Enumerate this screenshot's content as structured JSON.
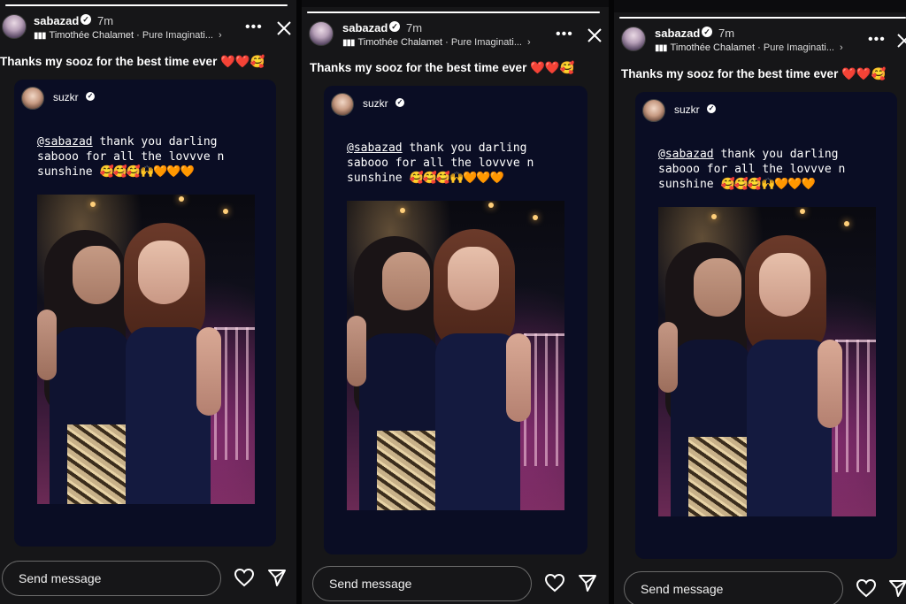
{
  "story": {
    "username": "sabazad",
    "time": "7m",
    "music_artist": "Timothée Chalamet",
    "music_song": "Pure Imaginati...",
    "caption_text": "Thanks my sooz for the best time ever",
    "caption_emojis": "❤️❤️🥰",
    "shared_post": {
      "username": "suzkr",
      "mention": "@sabazad",
      "text_line1_rest": " thank you darling",
      "text_line2": "sabooo for all the lovvve n",
      "text_line3": "sunshine",
      "text_emojis": "🥰🥰🥰🙌🧡🧡🧡"
    },
    "reply_placeholder": "Send message",
    "progress_fraction": 1.0
  },
  "icons": {
    "more": "more-icon",
    "close": "close-icon",
    "like": "heart-icon",
    "send": "send-icon",
    "verified": "verified-badge-icon",
    "music": "music-bars-icon"
  },
  "colors": {
    "background": "#161618",
    "card": "#0a0d24",
    "heart": "#e0283a"
  }
}
